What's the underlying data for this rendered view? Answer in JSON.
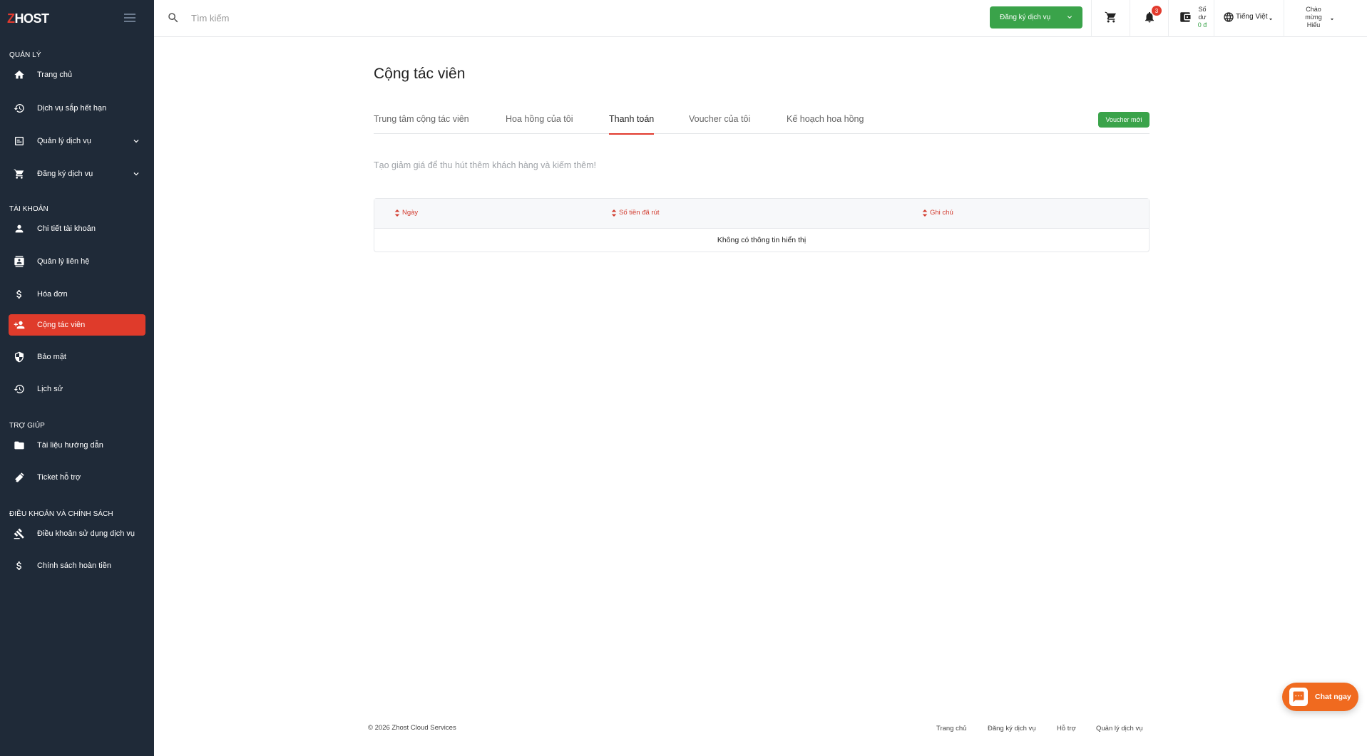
{
  "brand": {
    "logo_z": "Z",
    "logo_rest": "HOST"
  },
  "sidebar": {
    "sections": {
      "manage": "QUẢN LÝ",
      "account": "TÀI KHOẢN",
      "help": "TRỢ GIÚP",
      "policy": "ĐIỀU KHOẢN VÀ CHÍNH SÁCH"
    },
    "items": [
      {
        "label": "Trang chủ",
        "icon": "home-icon"
      },
      {
        "label": "Dịch vụ sắp hết hạn",
        "icon": "history-icon"
      },
      {
        "label": "Quản lý dịch vụ",
        "icon": "service-box-icon"
      },
      {
        "label": "Đăng ký dịch vụ",
        "icon": "cart-icon"
      },
      {
        "label": "Chi tiết tài khoản",
        "icon": "user-icon"
      },
      {
        "label": "Quản lý liên hệ",
        "icon": "contact-icon"
      },
      {
        "label": "Hóa đơn",
        "icon": "dollar-icon"
      },
      {
        "label": "Cộng tác viên",
        "icon": "user-plus-icon",
        "active": true
      },
      {
        "label": "Bảo mật",
        "icon": "shield-icon"
      },
      {
        "label": "Lịch sử",
        "icon": "history-icon"
      },
      {
        "label": "Tài liệu hướng dẫn",
        "icon": "folder-icon"
      },
      {
        "label": "Ticket hỗ trợ",
        "icon": "ticket-icon"
      },
      {
        "label": "Điều khoản sử dụng dịch vụ",
        "icon": "gavel-icon"
      },
      {
        "label": "Chính sách hoàn tiền",
        "icon": "dollar-icon"
      }
    ]
  },
  "topbar": {
    "search_placeholder": "Tìm kiếm",
    "register_button": "Đăng ký dịch vụ",
    "notification_count": "3",
    "balance_label_1": "Số",
    "balance_label_2": "dư",
    "balance_amount": "0 đ",
    "language": "Tiếng Việt",
    "greeting_1": "Chào",
    "greeting_2": "mừng",
    "greeting_3": "Hiếu"
  },
  "main": {
    "title": "Cộng tác viên",
    "tabs": [
      {
        "label": "Trung tâm cộng tác viên"
      },
      {
        "label": "Hoa hồng của tôi"
      },
      {
        "label": "Thanh toán",
        "active": true
      },
      {
        "label": "Voucher của tôi"
      },
      {
        "label": "Kế hoạch hoa hồng"
      }
    ],
    "new_voucher_button": "Voucher mới",
    "subtitle": "Tạo giảm giá để thu hút thêm khách hàng và kiếm thêm!",
    "table": {
      "columns": [
        "Ngày",
        "Số tiền đã rút",
        "Ghi chú"
      ],
      "empty_text": "Không có thông tin hiển thị"
    }
  },
  "footer": {
    "copyright": "© 2026 Zhost Cloud Services",
    "links": [
      "Trang chủ",
      "Đăng ký dịch vụ",
      "Hỗ trợ",
      "Quản lý dịch vụ"
    ]
  },
  "chat": {
    "label": "Chat ngay"
  },
  "colors": {
    "sidebar_bg": "#1f2a38",
    "accent_red": "#df3b2b",
    "accent_green": "#3aa34a",
    "chat_orange": "#f06a1f"
  }
}
